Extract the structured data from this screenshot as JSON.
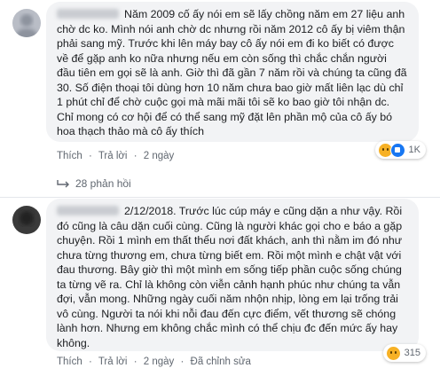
{
  "comments": [
    {
      "text": "Năm 2009 cố ấy nói em sẽ lấy chồng năm em 27 liệu anh chờ dc ko. Mình nói anh chờ dc nhưng rồi năm 2012 cô ấy bị viêm thận phải sang mỹ. Trước khi lên máy bay cô ấy nói em đi ko biết có được về để gặp anh ko nữa nhưng nếu em còn sống thì chắc chắn người đầu tiên em gọi sẽ là anh. Giờ thì đã gần 7 năm rồi và chúng ta cũng đã 30. Số điện thoại tôi dùng hơn 10 năm chưa bao giờ mất liên lạc dù chỉ 1 phút chỉ để chờ cuộc gọi mà mãi mãi tôi sẽ ko bao giờ tôi nhận dc. Chỉ mong có cơ hội để có thể sang mỹ đặt lên phần mộ của cô ấy bó hoa thạch thảo mà cô ấy thích",
      "actions": {
        "like": "Thích",
        "sep": "·",
        "reply": "Trả lời",
        "time": "2 ngày"
      },
      "reaction_count": "1K",
      "replies_label": "28 phản hồi"
    },
    {
      "text": "2/12/2018. Trước lúc cúp máy e cũng dặn a như vậy. Rồi đó cũng là câu dặn cuối cùng. Cũng là người khác gọi cho e báo a gặp chuyện. Rồi 1 mình em thất thểu nơi đất khách, anh thì nằm im đó như chưa từng thương em, chưa từng biết em. Rồi một mình e chật vật với đau thương. Bây giờ thì một mình em sống tiếp phần cuộc sống chúng ta từng vẽ ra. Chỉ là không còn viễn cảnh hạnh phúc như chúng ta vẫn đợi, vẫn mong. Những ngày cuối năm nhộn nhịp, lòng em lại trống trải vô cùng. Người ta nói khi nỗi đau đến cực điểm, vết thương sẽ chóng lành hơn. Nhưng em không chắc mình có thể chịu đc đến mức ấy hay không.",
      "actions": {
        "like": "Thích",
        "sep": "·",
        "reply": "Trả lời",
        "time": "2 ngày",
        "edited": "Đã chỉnh sửa"
      },
      "reaction_count": "315"
    }
  ],
  "icons": [
    "sad-reaction-icon",
    "like-reaction-icon",
    "reply-arrow-icon"
  ],
  "colors": {
    "bubble": "#f2f3f5",
    "meta_text": "#606770",
    "sad": "#f7b125",
    "like": "#1877f2"
  }
}
